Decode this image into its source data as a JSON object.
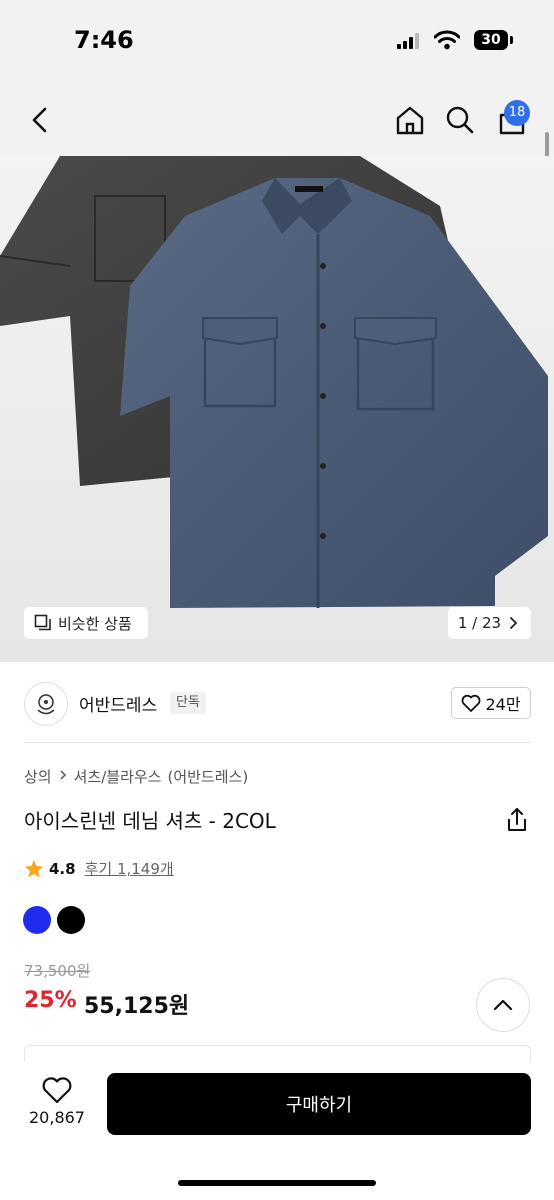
{
  "status_bar": {
    "time": "7:46",
    "battery": "30"
  },
  "header": {
    "cart_count": "18"
  },
  "gallery": {
    "similar_label": "비슷한 상품",
    "counter": "1 / 23"
  },
  "brand": {
    "name": "어반드레스",
    "badge": "단독",
    "likes": "24만"
  },
  "breadcrumb": [
    "상의",
    "셔츠/블라우스",
    "(어반드레스)"
  ],
  "product": {
    "title": "아이스린넨 데님 셔츠 - 2COL",
    "rating": "4.8",
    "reviews": "후기 1,149개",
    "colors": [
      "#1f2cf0",
      "#000000"
    ],
    "original_price": "73,500원",
    "discount": "25%",
    "sale_price": "55,125원"
  },
  "bottom_bar": {
    "wish_count": "20,867",
    "buy_label": "구매하기"
  },
  "colors": {
    "accent": "#2f6fe8",
    "discount": "#e0242d",
    "buy_button": "#000000"
  }
}
